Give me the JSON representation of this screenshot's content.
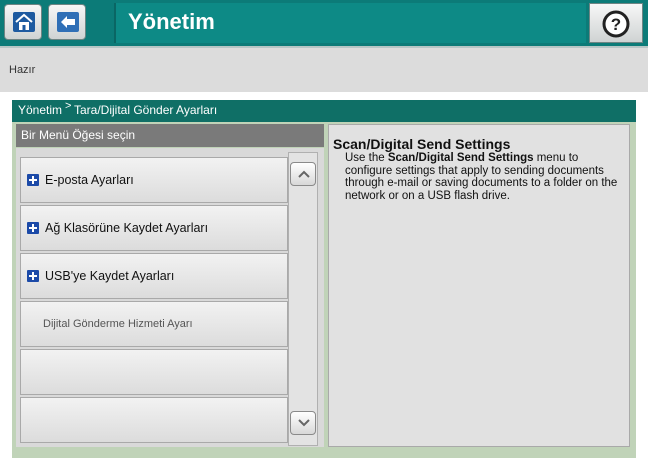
{
  "header": {
    "title": "Yönetim",
    "home_icon": "home-icon",
    "back_icon": "back-arrow-icon",
    "help_icon": "help-icon"
  },
  "status": {
    "text": "Hazır"
  },
  "breadcrumb": {
    "root": "Yönetim",
    "current": "Tara/Dijital Gönder Ayarları"
  },
  "menu": {
    "header": "Bir Menü Öğesi seçin",
    "items": [
      {
        "label": "E-posta Ayarları",
        "expandable": true
      },
      {
        "label": "Ağ Klasörüne Kaydet Ayarları",
        "expandable": true
      },
      {
        "label": "USB'ye Kaydet Ayarları",
        "expandable": true
      },
      {
        "label": "Dijital Gönderme Hizmeti Ayarı",
        "expandable": false
      }
    ]
  },
  "description": {
    "title": "Scan/Digital Send Settings",
    "intro": "Use the ",
    "strong": "Scan/Digital Send Settings",
    "rest": " menu to configure settings that apply to sending documents through e-mail or saving documents to a folder on the network or on a USB flash drive."
  },
  "colors": {
    "header_bg": "#0c7b78",
    "breadcrumb_bg": "#0f6f66",
    "frame_bg": "#c0d3b8",
    "plus_icon": "#1c4aa8"
  }
}
